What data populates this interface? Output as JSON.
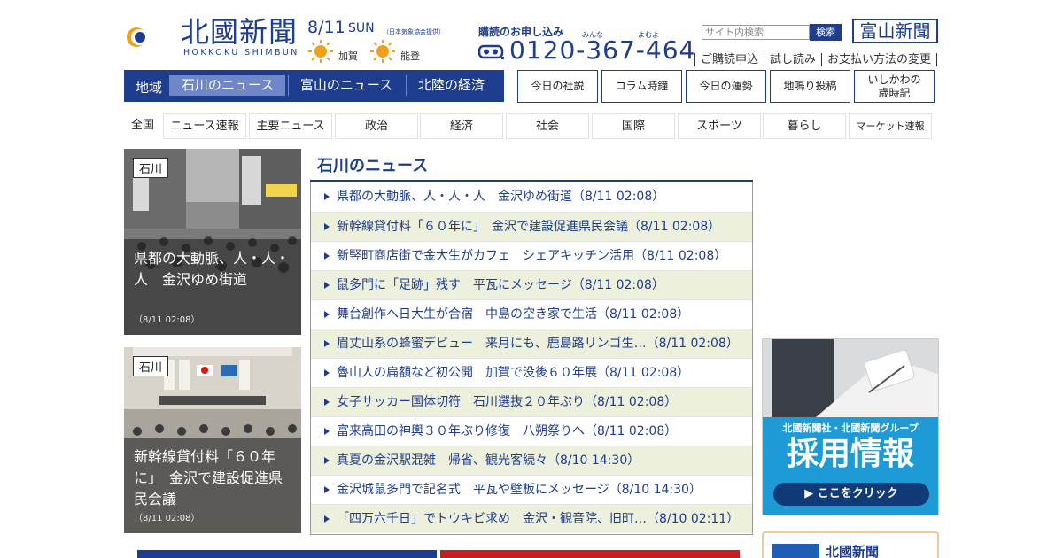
{
  "header": {
    "logo_text": "北國新聞",
    "logo_sub": "HOKKOKU SHIMBUN",
    "date": "8/11",
    "day_of_week": "SUN",
    "weather_note_prefix": "（日本気象協会",
    "weather_note_link": "提供",
    "weather_note_suffix": "）",
    "weather": [
      {
        "icon": "sun-icon",
        "label": "加賀"
      },
      {
        "icon": "sun-icon",
        "label": "能登"
      }
    ],
    "subscription_title": "購読のお申し込み",
    "phone_ruby_1": "みんな",
    "phone_ruby_2": "よむよ",
    "phone_number": "0120-367-464",
    "search_placeholder": "サイト内検索",
    "search_button": "検索",
    "toyama_button": "富山新聞",
    "sub_links": [
      "ご購読申込",
      "試し読み",
      "お支払い方法の変更"
    ]
  },
  "region_nav": {
    "label": "地域",
    "tabs": [
      {
        "label": "石川のニュース",
        "active": true
      },
      {
        "label": "富山のニュース",
        "active": false
      },
      {
        "label": "北陸の経済",
        "active": false
      }
    ]
  },
  "column_buttons": [
    "今日の社説",
    "コラム時鐘",
    "今日の運勢",
    "地鳴り投稿",
    "いしかわの\n歳時記"
  ],
  "categories": [
    "全国",
    "ニュース速報",
    "主要ニュース",
    "政治",
    "経済",
    "社会",
    "国際",
    "スポーツ",
    "暮らし",
    "マーケット速報"
  ],
  "features": [
    {
      "tag": "石川",
      "caption": "県都の大動脈、人・人・人　金沢ゆめ街道",
      "time": "（8/11 02:08）"
    },
    {
      "tag": "石川",
      "caption": "新幹線貸付料「６０年に」　金沢で建設促進県民会議",
      "time": "（8/11 02:08）"
    }
  ],
  "news": {
    "title": "石川のニュース",
    "items": [
      "県都の大動脈、人・人・人　金沢ゆめ街道（8/11 02:08）",
      "新幹線貸付料「６０年に」　金沢で建設促進県民会議（8/11 02:08）",
      "新竪町商店街で金大生がカフェ　シェアキッチン活用（8/11 02:08）",
      "鼠多門に「足跡」残す　平瓦にメッセージ（8/11 02:08）",
      "舞台創作へ日大生が合宿　中島の空き家で生活（8/11 02:08）",
      "眉丈山系の蜂蜜デビュー　来月にも、鹿島路リンゴ生…（8/11 02:08）",
      "魯山人の扁額など初公開　加賀で没後６０年展（8/11 02:08）",
      "女子サッカー国体切符　石川選抜２０年ぶり（8/11 02:08）",
      "富来高田の神輿３０年ぶり修復　八朔祭りへ（8/11 02:08）",
      "真夏の金沢駅混雑　帰省、観光客続々（8/10 14:30）",
      "金沢城鼠多門で記名式　平瓦や壁板にメッセージ（8/10 14:30）",
      "「四万六千日」でトウキビ求め　金沢・観音院、旧町…（8/10 02:11）"
    ]
  },
  "banner": {
    "line1": "北國新聞社・北國新聞グループ",
    "line2": "採用情報",
    "button": "▶ ここをクリック"
  },
  "box2": {
    "small": "北國新聞",
    "title": "北國新聞"
  },
  "colors": {
    "brand": "#1f3d8f",
    "accent_tab": "#6f86c8",
    "alt_row": "#edf0dc",
    "banner_blue": "#1e9ad6"
  }
}
